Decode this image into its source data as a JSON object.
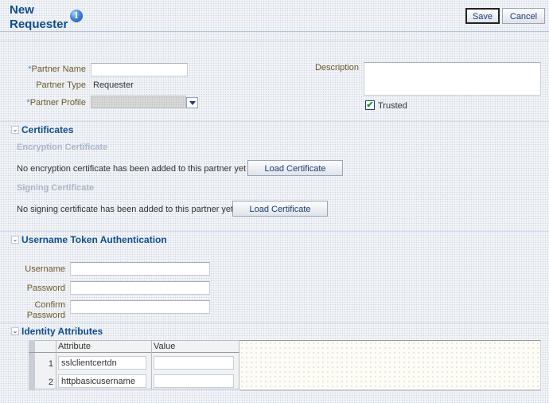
{
  "header": {
    "title": "New Requester",
    "info_icon": "info-icon",
    "save_label": "Save",
    "cancel_label": "Cancel"
  },
  "partner": {
    "name_label": "Partner Name",
    "name_value": "",
    "type_label": "Partner Type",
    "type_value": "Requester",
    "profile_label": "Partner Profile",
    "profile_value": "",
    "required_marker": "*",
    "description_label": "Description",
    "description_value": "",
    "trusted_label": "Trusted",
    "trusted_checked": true,
    "check_glyph": "✔"
  },
  "certificates": {
    "title": "Certificates",
    "disclosure_glyph": "⌄",
    "encryption_title": "Encryption Certificate",
    "encryption_message": "No encryption certificate has been added to this partner yet",
    "encryption_button": "Load Certificate",
    "signing_title": "Signing Certificate",
    "signing_message": "No signing certificate has been added to this partner yet",
    "signing_button": "Load Certificate"
  },
  "username_token": {
    "title": "Username Token Authentication",
    "username_label": "Username",
    "username_value": "",
    "password_label": "Password",
    "password_value": "",
    "confirm_label_line1": "Confirm",
    "confirm_label_line2": "Password",
    "confirm_value": ""
  },
  "identity_attributes": {
    "title": "Identity Attributes",
    "columns": [
      "Attribute",
      "Value"
    ],
    "rows": [
      {
        "index": "1",
        "attribute": "sslclientcertdn",
        "value": ""
      },
      {
        "index": "2",
        "attribute": "httpbasicusername",
        "value": ""
      }
    ]
  }
}
